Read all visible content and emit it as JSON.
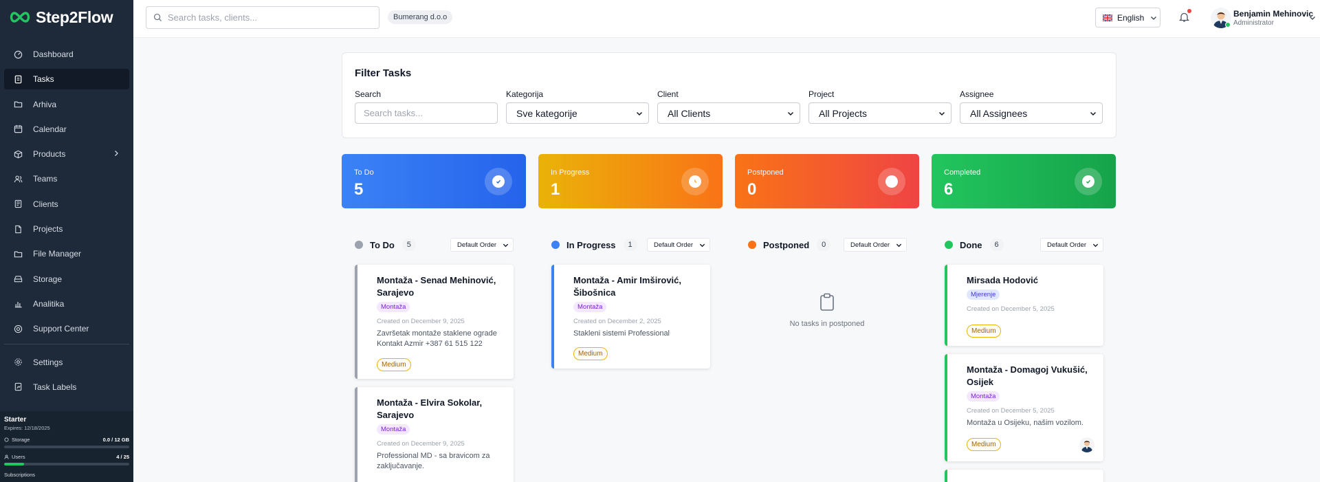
{
  "brand": {
    "name": "Step2Flow"
  },
  "sidebar": {
    "items": [
      {
        "label": "Dashboard",
        "icon": "dashboard-icon"
      },
      {
        "label": "Tasks",
        "icon": "tasks-icon"
      },
      {
        "label": "Arhiva",
        "icon": "folder-icon"
      },
      {
        "label": "Calendar",
        "icon": "calendar-icon"
      },
      {
        "label": "Products",
        "icon": "box-icon"
      },
      {
        "label": "Teams",
        "icon": "teams-icon"
      },
      {
        "label": "Clients",
        "icon": "clients-icon"
      },
      {
        "label": "Projects",
        "icon": "projects-icon"
      },
      {
        "label": "File Manager",
        "icon": "folder-icon"
      },
      {
        "label": "Storage",
        "icon": "storage-icon"
      },
      {
        "label": "Analitika",
        "icon": "chart-icon"
      },
      {
        "label": "Support Center",
        "icon": "support-icon"
      },
      {
        "label": "Settings",
        "icon": "gear-icon"
      },
      {
        "label": "Task Labels",
        "icon": "label-icon"
      }
    ],
    "active": "Tasks",
    "plan": {
      "name": "Starter",
      "expires": "Expires: 12/18/2025",
      "storage_label": "Storage",
      "storage_value": "0.0 / 12 GB",
      "storage_fraction": 0.0,
      "users_label": "Users",
      "users_value": "4 / 25",
      "users_fraction": 0.16,
      "subscriptions_label": "Subscriptions"
    }
  },
  "topbar": {
    "search_placeholder": "Search tasks, clients...",
    "company": "Bumerang d.o.o",
    "language": "English",
    "user_name": "Benjamin Mehinovic",
    "user_role": "Administrator"
  },
  "filters": {
    "title": "Filter Tasks",
    "search_label": "Search",
    "search_placeholder": "Search tasks...",
    "category_label": "Kategorija",
    "category_value": "Sve kategorije",
    "client_label": "Client",
    "client_value": "All Clients",
    "project_label": "Project",
    "project_value": "All Projects",
    "assignee_label": "Assignee",
    "assignee_value": "All Assignees"
  },
  "stats": [
    {
      "label": "To Do",
      "value": "5",
      "color_from": "#3b82f6",
      "color_to": "#2563eb"
    },
    {
      "label": "In Progress",
      "value": "1",
      "color_from": "#eab308",
      "color_to": "#f97316"
    },
    {
      "label": "Postponed",
      "value": "0",
      "color_from": "#f97316",
      "color_to": "#ef4444"
    },
    {
      "label": "Completed",
      "value": "6",
      "color_from": "#22c55e",
      "color_to": "#16a34a"
    }
  ],
  "columns": [
    {
      "title": "To Do",
      "count": "5",
      "dot": "#9ca3af",
      "order": "Default Order"
    },
    {
      "title": "In Progress",
      "count": "1",
      "dot": "#3b82f6",
      "order": "Default Order"
    },
    {
      "title": "Postponed",
      "count": "0",
      "dot": "#f97316",
      "order": "Default Order"
    },
    {
      "title": "Done",
      "count": "6",
      "dot": "#22c55e",
      "order": "Default Order"
    }
  ],
  "empty_postponed": "No tasks in postponed",
  "tasks": {
    "todo": [
      {
        "title": "Montaža - Senad Mehinović, Sarajevo",
        "tag": "Montaža",
        "created": "Created on December 9, 2025",
        "desc": "Završetak montaže staklene ograde Kontakt Azmir +387 61 515 122",
        "priority": "Medium"
      },
      {
        "title": "Montaža - Elvira Sokolar, Sarajevo",
        "tag": "Montaža",
        "created": "Created on December 9, 2025",
        "desc": "Professional MD - sa bravicom za zaključavanje."
      }
    ],
    "inprogress": [
      {
        "title": "Montaža - Amir Imširović, Šibošnica",
        "tag": "Montaža",
        "created": "Created on December 2, 2025",
        "desc": "Stakleni sistemi Professional",
        "priority": "Medium"
      }
    ],
    "done": [
      {
        "title": "Mirsada Hodović",
        "tag": "Mjerenje",
        "created": "Created on December 5, 2025",
        "priority": "Medium"
      },
      {
        "title": "Montaža - Domagoj Vukušić, Osijek",
        "tag": "Montaža",
        "created": "Created on December 5, 2025",
        "desc": "Montaža u Osijeku, našim vozilom.",
        "priority": "Medium"
      }
    ]
  }
}
